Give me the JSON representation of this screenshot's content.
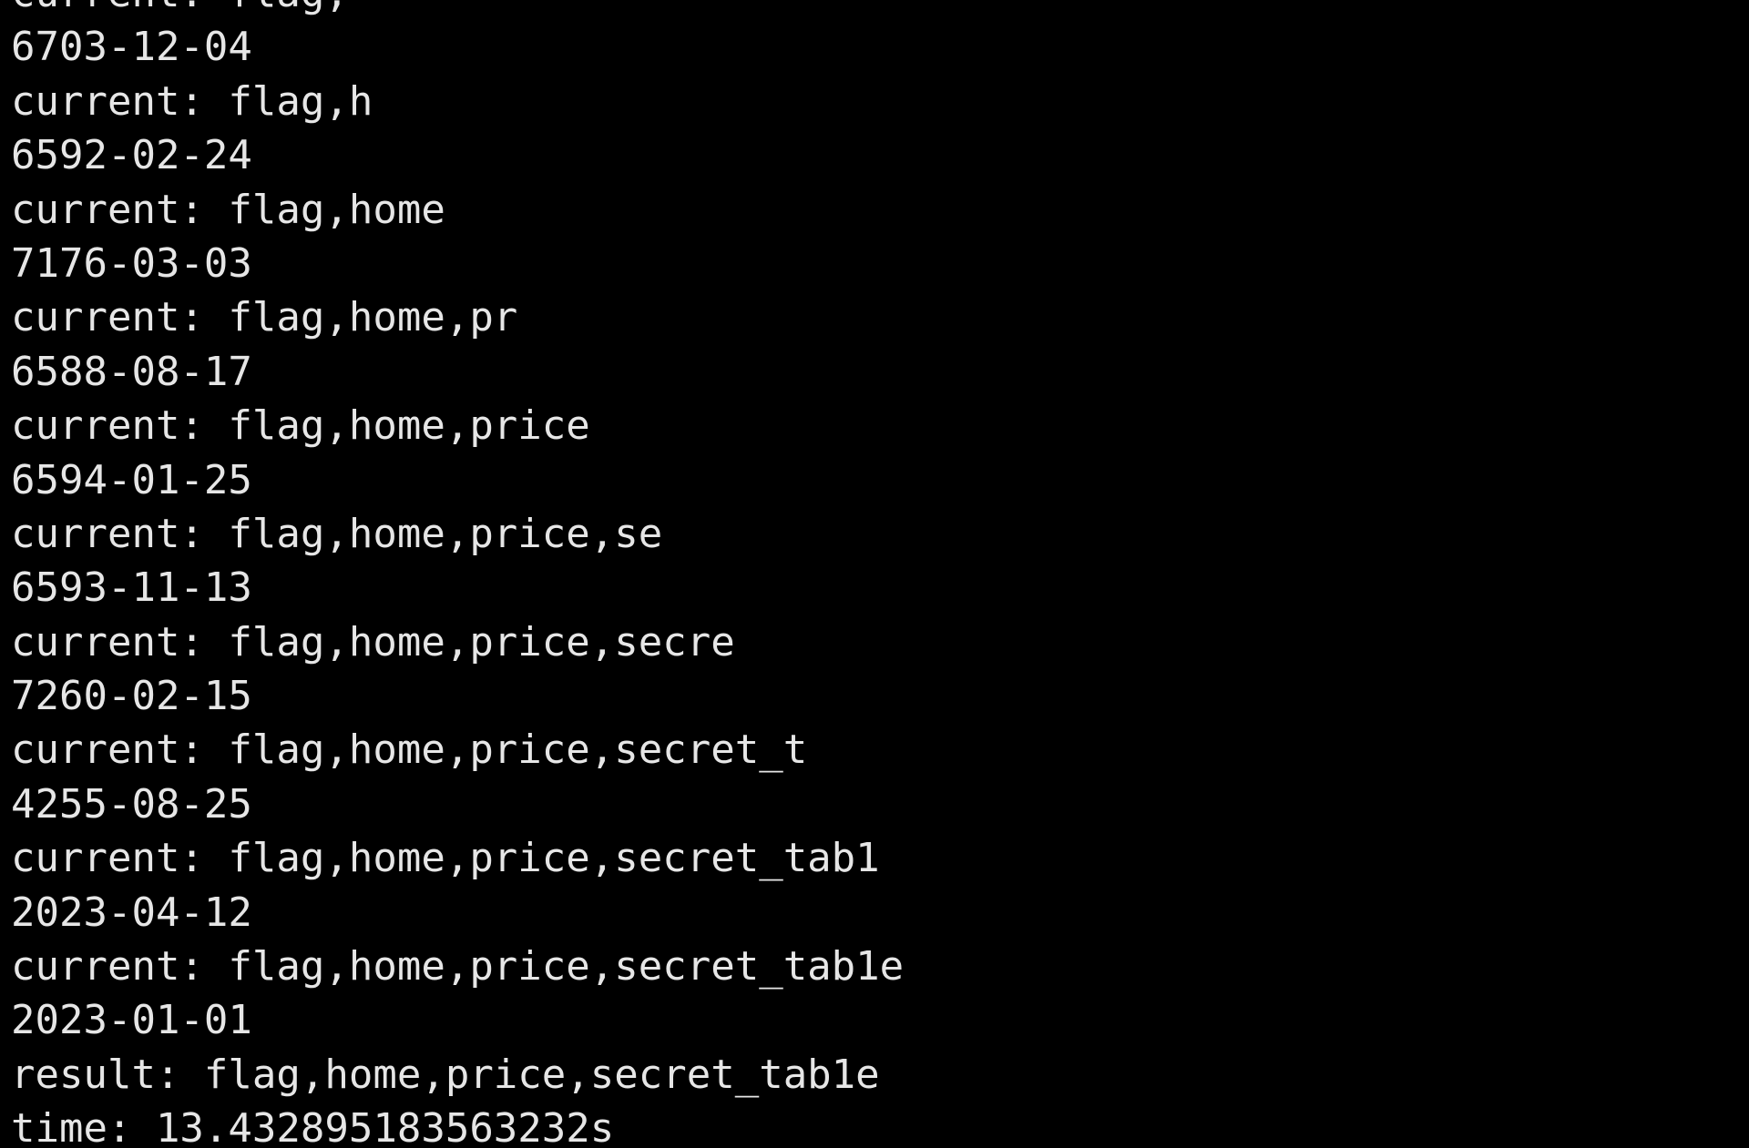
{
  "terminal": {
    "background": "#000000",
    "foreground": "#e6e6e6",
    "lines": [
      "current: flag,",
      "6703-12-04",
      "current: flag,h",
      "6592-02-24",
      "current: flag,home",
      "7176-03-03",
      "current: flag,home,pr",
      "6588-08-17",
      "current: flag,home,price",
      "6594-01-25",
      "current: flag,home,price,se",
      "6593-11-13",
      "current: flag,home,price,secre",
      "7260-02-15",
      "current: flag,home,price,secret_t",
      "4255-08-25",
      "current: flag,home,price,secret_tab1",
      "2023-04-12",
      "current: flag,home,price,secret_tab1e",
      "2023-01-01",
      "result: flag,home,price,secret_tab1e",
      "time: 13.432895183563232s"
    ]
  }
}
